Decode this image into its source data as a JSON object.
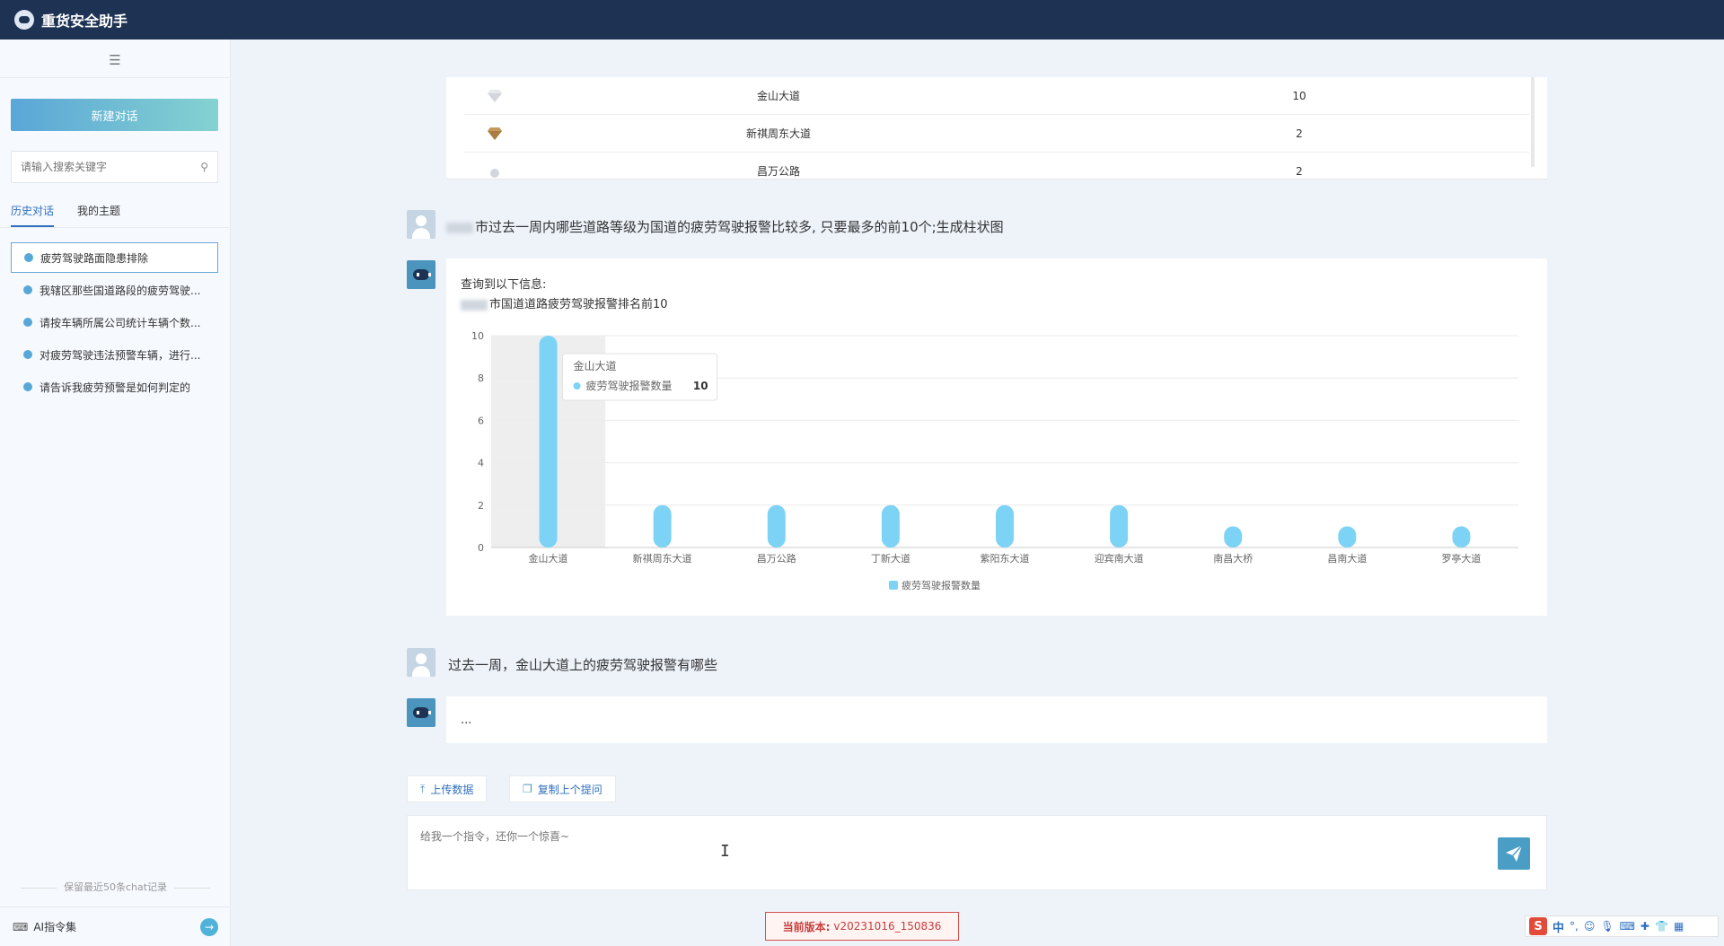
{
  "app": {
    "title": "重货安全助手"
  },
  "sidebar": {
    "new_chat_label": "新建对话",
    "search_placeholder": "请输入搜索关键字",
    "tabs": [
      {
        "label": "历史对话",
        "active": true
      },
      {
        "label": "我的主题",
        "active": false
      }
    ],
    "history": [
      {
        "label": "疲劳驾驶路面隐患排除",
        "selected": true
      },
      {
        "label": "我辖区那些国道路段的疲劳驾驶...",
        "selected": false
      },
      {
        "label": "请按车辆所属公司统计车辆个数...",
        "selected": false
      },
      {
        "label": "对疲劳驾驶违法预警车辆，进行...",
        "selected": false
      },
      {
        "label": "请告诉我疲劳预警是如何判定的",
        "selected": false
      }
    ],
    "keep_note": "保留最近50条chat记录",
    "ai_commands_label": "AI指令集"
  },
  "table_snippet": {
    "rows": [
      {
        "name": "金山大道",
        "count": "10",
        "gem_color": "#c9cdd3"
      },
      {
        "name": "新祺周东大道",
        "count": "2",
        "gem_color": "#a87d3f"
      },
      {
        "name": "昌万公路",
        "count": "2",
        "gem_color": "#c9cdd3"
      }
    ]
  },
  "messages": {
    "question1": "市过去一周内哪些道路等级为国道的疲劳驾驶报警比较多, 只要最多的前10个;生成柱状图",
    "answer1_line1": "查询到以下信息:",
    "answer1_line2": "市国道道路疲劳驾驶报警排名前10",
    "question2": "过去一周，金山大道上的疲劳驾驶报警有哪些",
    "answer2": "..."
  },
  "tooltip": {
    "title": "金山大道",
    "series": "疲劳驾驶报警数量",
    "value": "10"
  },
  "toolbar": {
    "upload_label": "上传数据",
    "copy_label": "复制上个提问"
  },
  "input": {
    "placeholder": "给我一个指令，还你一个惊喜~"
  },
  "footer": {
    "version_label": "当前版本:",
    "version_value": "v20231016_150836"
  },
  "ime": {
    "mode": "中"
  },
  "colors": {
    "topbar": "#1e3354",
    "bar": "#7dd3f5",
    "accent": "#2f6fbf"
  },
  "chart_data": {
    "type": "bar",
    "categories": [
      "金山大道",
      "新祺周东大道",
      "昌万公路",
      "丁新大道",
      "紫阳东大道",
      "迎宾南大道",
      "南昌大桥",
      "昌南大道",
      "罗亭大道"
    ],
    "series": [
      {
        "name": "疲劳驾驶报警数量",
        "values": [
          10,
          2,
          2,
          2,
          2,
          2,
          1,
          1,
          1
        ]
      }
    ],
    "yticks": [
      0,
      2,
      4,
      6,
      8,
      10
    ],
    "ylim": [
      0,
      10
    ],
    "grid": true,
    "legend_position": "bottom-center",
    "highlighted_category": "金山大道"
  }
}
